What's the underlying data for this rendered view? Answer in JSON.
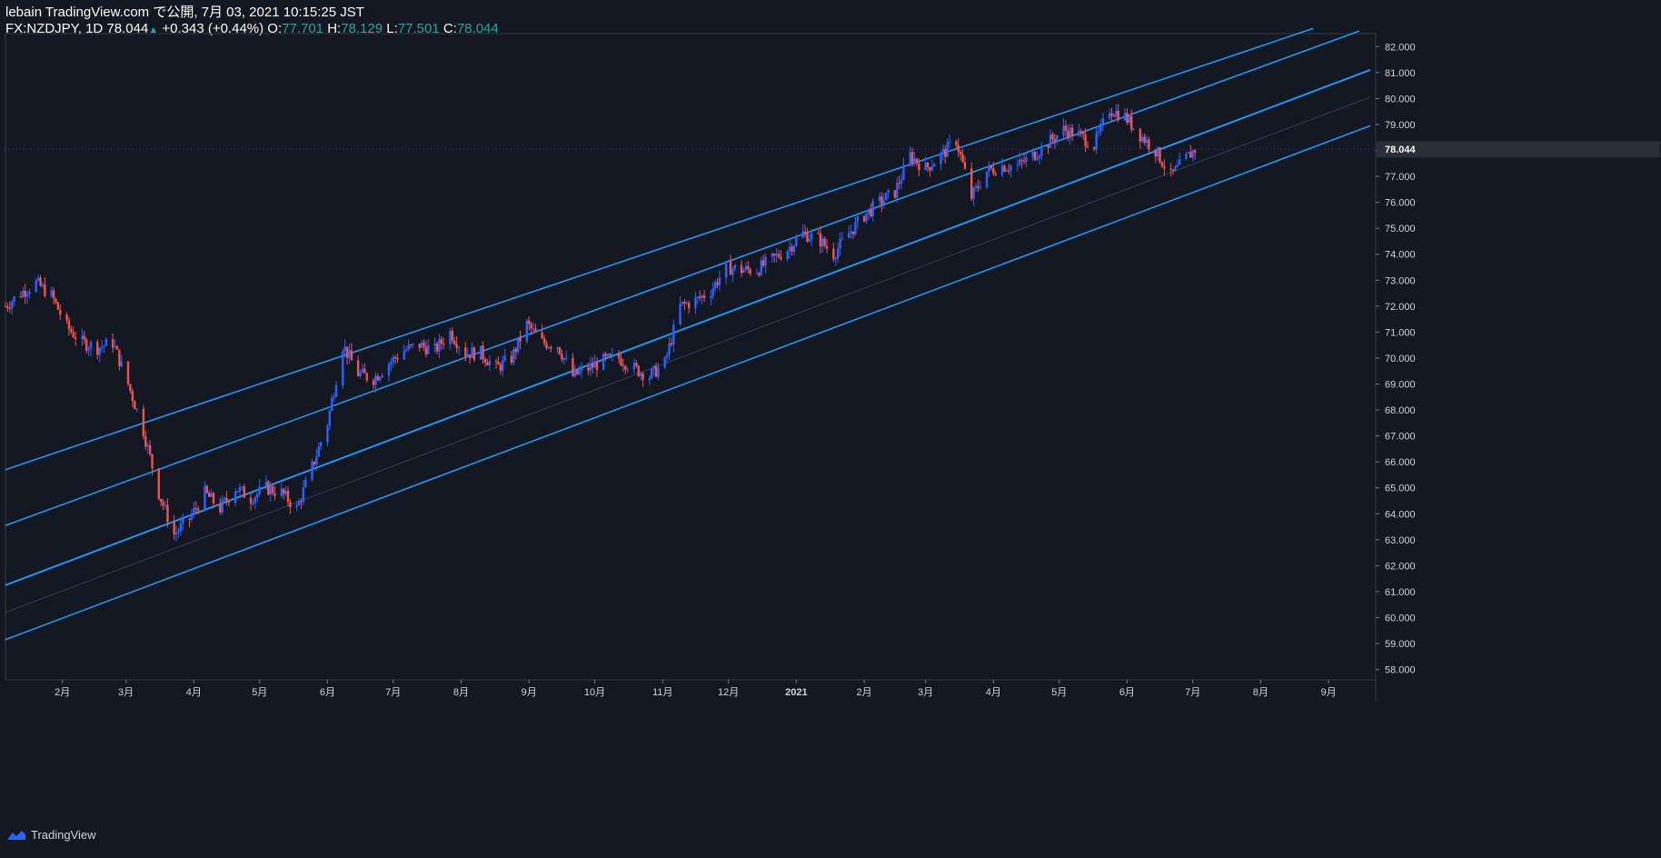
{
  "header": {
    "publisher": "lebain TradingView.com で公開, 7月 03, 2021 10:15:25 JST",
    "symbol": "FX:NZDJPY, 1D",
    "last": "78.044",
    "change": "+0.343 (+0.44%)",
    "o_label": "O:",
    "o": "77.701",
    "h_label": "H:",
    "h": "78.129",
    "l_label": "L:",
    "l": "77.501",
    "c_label": "C:",
    "c": "78.044"
  },
  "footer": {
    "brand": "TradingView"
  },
  "colors": {
    "background": "#131722",
    "up": "#2962ff",
    "down": "#ef5350",
    "channel": "#2196f3",
    "axis_text": "#d1d4dc"
  },
  "chart_data": {
    "type": "candlestick",
    "symbol": "FX:NZDJPY",
    "interval": "1D",
    "y_ticks": [
      "82.000",
      "81.000",
      "80.000",
      "79.000",
      "78.000",
      "77.000",
      "76.000",
      "75.000",
      "74.000",
      "73.000",
      "72.000",
      "71.000",
      "70.000",
      "69.000",
      "68.000",
      "67.000",
      "66.000",
      "65.000",
      "64.000",
      "63.000",
      "62.000",
      "61.000",
      "60.000",
      "59.000",
      "58.000"
    ],
    "ylim": [
      57.6,
      82.5
    ],
    "last_price_label": "78.044",
    "x_ticks": [
      "2月",
      "3月",
      "4月",
      "5月",
      "6月",
      "7月",
      "8月",
      "9月",
      "10月",
      "11月",
      "12月",
      "2021",
      "2月",
      "3月",
      "4月",
      "5月",
      "6月",
      "7月",
      "8月",
      "9月"
    ],
    "close_path": [
      [
        "2020-01-06",
        72.0
      ],
      [
        "2020-01-13",
        72.5
      ],
      [
        "2020-01-20",
        72.9
      ],
      [
        "2020-01-27",
        72.4
      ],
      [
        "2020-02-03",
        71.2
      ],
      [
        "2020-02-10",
        70.6
      ],
      [
        "2020-02-17",
        70.4
      ],
      [
        "2020-02-24",
        70.6
      ],
      [
        "2020-03-02",
        69.0
      ],
      [
        "2020-03-09",
        67.2
      ],
      [
        "2020-03-16",
        64.8
      ],
      [
        "2020-03-23",
        63.2
      ],
      [
        "2020-03-30",
        63.8
      ],
      [
        "2020-04-06",
        64.8
      ],
      [
        "2020-04-13",
        64.2
      ],
      [
        "2020-04-20",
        65.0
      ],
      [
        "2020-04-27",
        64.6
      ],
      [
        "2020-05-04",
        65.0
      ],
      [
        "2020-05-11",
        64.8
      ],
      [
        "2020-05-18",
        64.2
      ],
      [
        "2020-05-25",
        65.8
      ],
      [
        "2020-06-01",
        67.5
      ],
      [
        "2020-06-08",
        70.5
      ],
      [
        "2020-06-15",
        69.4
      ],
      [
        "2020-06-22",
        69.2
      ],
      [
        "2020-06-29",
        69.8
      ],
      [
        "2020-07-06",
        70.3
      ],
      [
        "2020-07-13",
        70.5
      ],
      [
        "2020-07-20",
        70.3
      ],
      [
        "2020-07-27",
        71.0
      ],
      [
        "2020-08-03",
        70.2
      ],
      [
        "2020-08-10",
        70.2
      ],
      [
        "2020-08-17",
        69.6
      ],
      [
        "2020-08-24",
        70.0
      ],
      [
        "2020-08-31",
        71.3
      ],
      [
        "2020-09-07",
        70.6
      ],
      [
        "2020-09-14",
        70.5
      ],
      [
        "2020-09-21",
        69.3
      ],
      [
        "2020-09-28",
        69.6
      ],
      [
        "2020-10-05",
        69.9
      ],
      [
        "2020-10-12",
        70.0
      ],
      [
        "2020-10-19",
        69.6
      ],
      [
        "2020-10-26",
        69.3
      ],
      [
        "2020-11-02",
        69.8
      ],
      [
        "2020-11-09",
        72.0
      ],
      [
        "2020-11-16",
        72.2
      ],
      [
        "2020-11-23",
        72.6
      ],
      [
        "2020-11-30",
        73.5
      ],
      [
        "2020-12-07",
        73.4
      ],
      [
        "2020-12-14",
        73.4
      ],
      [
        "2020-12-21",
        73.8
      ],
      [
        "2020-12-28",
        74.2
      ],
      [
        "2021-01-04",
        74.8
      ],
      [
        "2021-01-11",
        74.6
      ],
      [
        "2021-01-18",
        74.0
      ],
      [
        "2021-01-25",
        74.8
      ],
      [
        "2021-02-01",
        75.5
      ],
      [
        "2021-02-08",
        76.0
      ],
      [
        "2021-02-15",
        76.4
      ],
      [
        "2021-02-22",
        77.8
      ],
      [
        "2021-03-01",
        77.3
      ],
      [
        "2021-03-08",
        77.8
      ],
      [
        "2021-03-15",
        78.4
      ],
      [
        "2021-03-22",
        76.2
      ],
      [
        "2021-03-29",
        77.2
      ],
      [
        "2021-04-05",
        77.4
      ],
      [
        "2021-04-12",
        77.4
      ],
      [
        "2021-04-19",
        77.8
      ],
      [
        "2021-04-26",
        78.3
      ],
      [
        "2021-05-03",
        78.8
      ],
      [
        "2021-05-10",
        78.6
      ],
      [
        "2021-05-17",
        78.2
      ],
      [
        "2021-05-24",
        79.6
      ],
      [
        "2021-05-31",
        79.3
      ],
      [
        "2021-06-07",
        78.6
      ],
      [
        "2021-06-14",
        78.0
      ],
      [
        "2021-06-21",
        77.0
      ],
      [
        "2021-06-28",
        77.7
      ],
      [
        "2021-07-02",
        78.044
      ]
    ],
    "channel_lines": [
      {
        "from": [
          "2020-01-06",
          65.7
        ],
        "to": [
          "2021-08-25",
          82.7
        ]
      },
      {
        "from": [
          "2020-01-06",
          63.55
        ],
        "to": [
          "2021-09-15",
          82.6
        ]
      },
      {
        "from": [
          "2020-01-06",
          61.25
        ],
        "to": [
          "2021-09-20",
          81.1
        ]
      },
      {
        "from": [
          "2020-01-06",
          59.15
        ],
        "to": [
          "2021-09-20",
          78.95
        ]
      }
    ]
  }
}
